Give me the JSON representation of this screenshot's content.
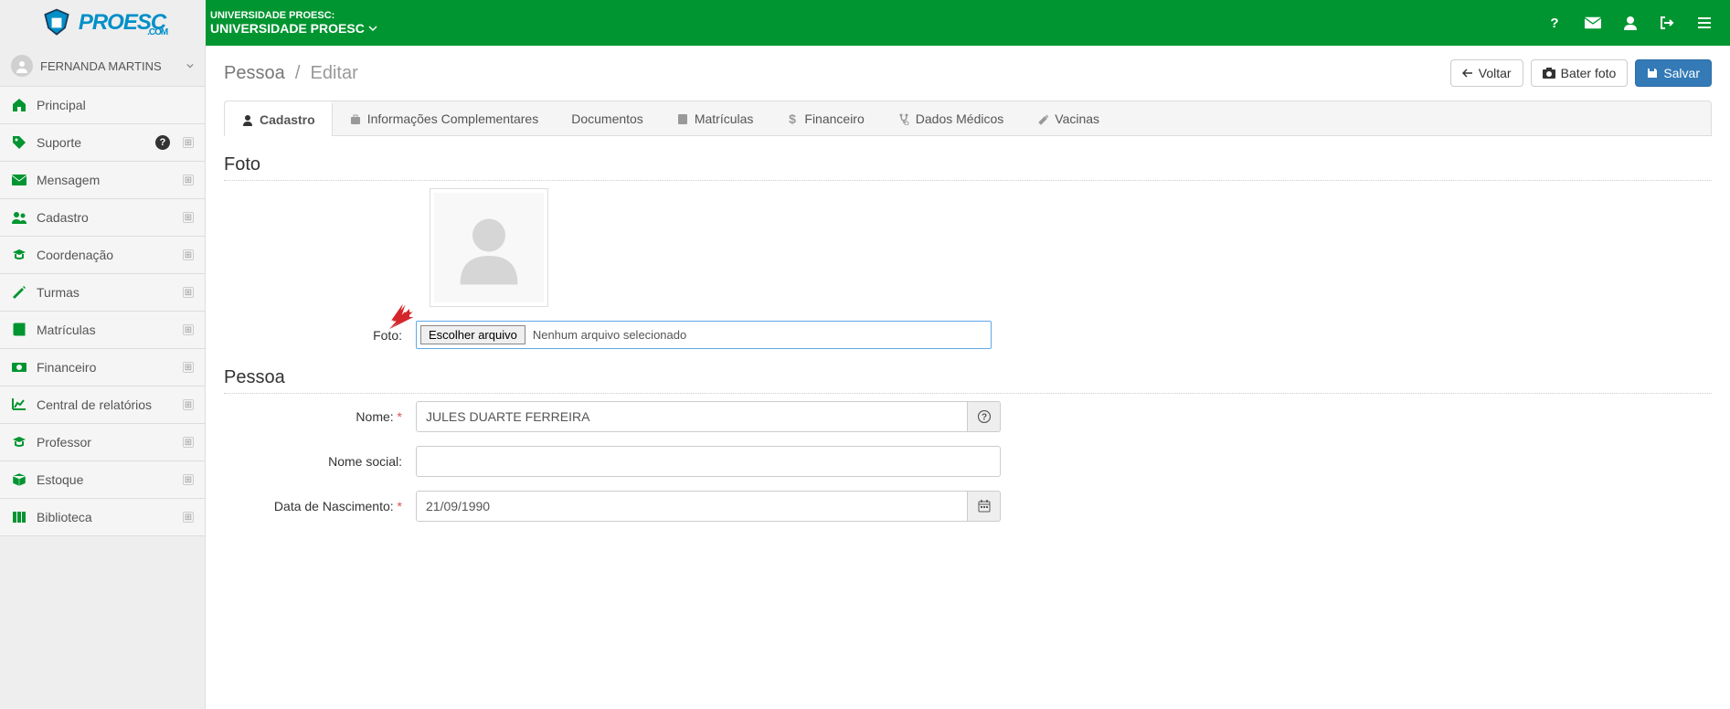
{
  "header": {
    "org_label": "UNIVERSIDADE PROESC:",
    "org_name": "UNIVERSIDADE PROESC",
    "logo_main": "PROESC",
    "logo_sub": ".COM"
  },
  "sidebar": {
    "user": "FERNANDA MARTINS",
    "items": [
      {
        "label": "Principal",
        "icon": "home",
        "expandable": false
      },
      {
        "label": "Suporte",
        "icon": "tag",
        "expandable": true,
        "help": true
      },
      {
        "label": "Mensagem",
        "icon": "envelope",
        "expandable": true
      },
      {
        "label": "Cadastro",
        "icon": "users",
        "expandable": true
      },
      {
        "label": "Coordenação",
        "icon": "grad",
        "expandable": true
      },
      {
        "label": "Turmas",
        "icon": "pencil",
        "expandable": true
      },
      {
        "label": "Matrículas",
        "icon": "book",
        "expandable": true
      },
      {
        "label": "Financeiro",
        "icon": "money",
        "expandable": true
      },
      {
        "label": "Central de relatórios",
        "icon": "chart",
        "expandable": true
      },
      {
        "label": "Professor",
        "icon": "grad",
        "expandable": true
      },
      {
        "label": "Estoque",
        "icon": "cube",
        "expandable": true
      },
      {
        "label": "Biblioteca",
        "icon": "library",
        "expandable": true
      }
    ]
  },
  "breadcrumb": {
    "main": "Pessoa",
    "sub": "Editar"
  },
  "actions": {
    "back": "Voltar",
    "photo": "Bater foto",
    "save": "Salvar"
  },
  "tabs": [
    {
      "label": "Cadastro",
      "icon": "user"
    },
    {
      "label": "Informações Complementares",
      "icon": "briefcase"
    },
    {
      "label": "Documentos",
      "icon": ""
    },
    {
      "label": "Matrículas",
      "icon": "book"
    },
    {
      "label": "Financeiro",
      "icon": "dollar"
    },
    {
      "label": "Dados Médicos",
      "icon": "stetho"
    },
    {
      "label": "Vacinas",
      "icon": "syringe"
    }
  ],
  "sections": {
    "foto_title": "Foto",
    "foto_label": "Foto:",
    "file_button": "Escolher arquivo",
    "file_status": "Nenhum arquivo selecionado",
    "pessoa_title": "Pessoa",
    "nome_label": "Nome:",
    "nome_value": "JULES DUARTE FERREIRA",
    "nome_social_label": "Nome social:",
    "nome_social_value": "",
    "dob_label": "Data de Nascimento:",
    "dob_value": "21/09/1990"
  }
}
